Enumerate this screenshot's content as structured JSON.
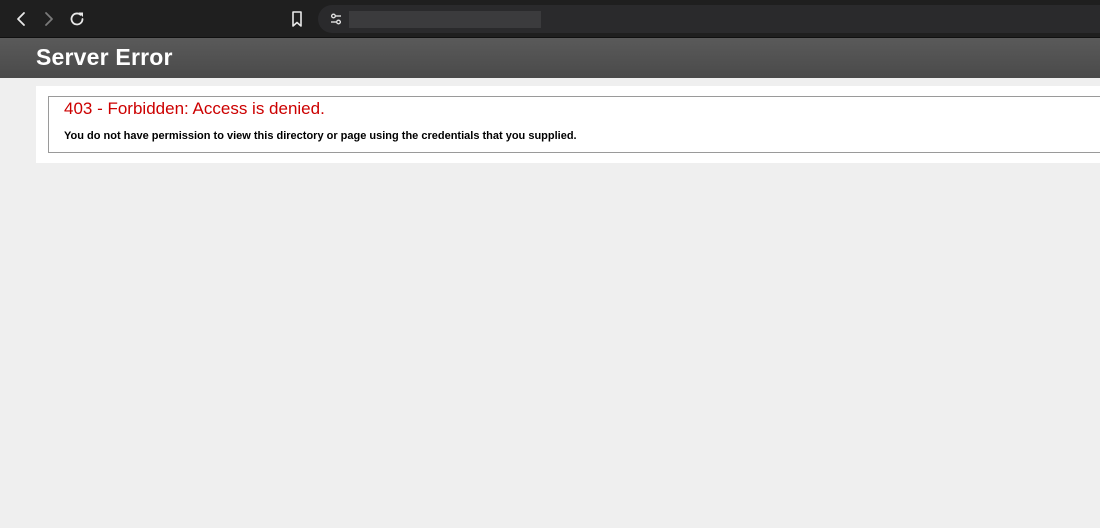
{
  "browser": {
    "back_icon": "chevron-left-icon",
    "forward_icon": "chevron-right-icon",
    "reload_icon": "reload-icon",
    "bookmark_icon": "bookmark-icon",
    "site_info_icon": "tune-icon",
    "url": ""
  },
  "page": {
    "header_title": "Server Error",
    "error_heading": "403 - Forbidden: Access is denied.",
    "error_message": "You do not have permission to view this directory or page using the credentials that you supplied."
  },
  "colors": {
    "toolbar_bg": "#1f1f1f",
    "header_bg": "#555555",
    "error_red": "#cc0000",
    "page_bg": "#efefef"
  }
}
